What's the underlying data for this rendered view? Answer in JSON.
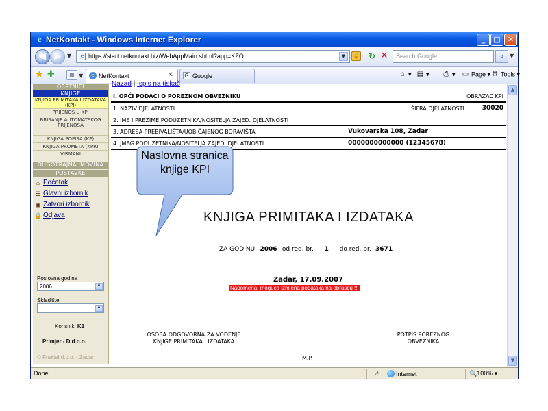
{
  "window": {
    "title": "NetKontakt - Windows Internet Explorer",
    "minimize": "_",
    "maximize": "□",
    "close": "✕"
  },
  "addressbar": {
    "url": "https://start.netkontakt.biz/WebAppMain.shtml?app=KZO",
    "search_placeholder": "Search Google"
  },
  "tabs": [
    {
      "label": "NetKontakt",
      "active": true
    },
    {
      "label": "Google",
      "active": false
    }
  ],
  "commands": {
    "page": "Page",
    "tools": "Tools"
  },
  "sidebar": {
    "header1": "OBRTNICI",
    "header2": "KNJIGE",
    "items": [
      "KNJIGA PRIMITAKA I IZDATAKA (KPI)",
      "PRIJENOS U KPI",
      "BRISANJE AUTOMATSKOG PRIJENOSA",
      "KNJIGA POPISA (KP)",
      "KNJIGA PROMETA (KPR)",
      "VIRMANI"
    ],
    "header3": "DUGOTRAJNA IMOVINA",
    "header4": "POSTAVKE",
    "links": [
      "Početak",
      "Glavni izbornik",
      "Zatvori izbornik",
      "Odjava"
    ],
    "year_label": "Poslovna godina",
    "year_value": "2006",
    "warehouse_label": "Skladište",
    "warehouse_value": "",
    "user_label": "Korisnik:",
    "user_value": "K1",
    "company": "Primjer - D d.o.o.",
    "footer": "© Fraktal d.o.o. - Zadar"
  },
  "main": {
    "link_back": "Nazad",
    "link_print": "Ispis na tiskač",
    "sep": "|",
    "row1_left": "I. OPĆI PODACI O POREZNOM OBVEZNIKU",
    "row1_right": "OBRAZAC KPI",
    "row2_left": "1. NAZIV DJELATNOSTI",
    "row2_code_label": "ŠIFRA DJELATNOSTI",
    "row2_code_value": "30020",
    "row3_left": "2. IME I PREZIME PODUZETNIKA/NOSITELJA ZAJED. DJELATNOSTI",
    "row4_left": "3. ADRESA PREBIVALIŠTA/UOBIČAJENOG BORAVIŠTA",
    "row4_value": "Vukovarska 108, Zadar",
    "row5_left": "4. JMBG PODUZETNIKA/NOSITELJA ZAJED. DJELATNOSTI",
    "row5_value": "0000000000000 (12345678)",
    "callout": "Naslovna stranica knjige KPI",
    "title": "KNJIGA PRIMITAKA I IZDATAKA",
    "year_prefix": "ZA GODINU",
    "year": "2006",
    "from_label": "od red. br.",
    "from": "1",
    "to_label": "do red. br.",
    "to": "3671",
    "date": "Zadar, 17.09.2007",
    "notice": "Napomena: moguća izmjena podataka na obrascu !!!",
    "sig_left_line1": "OSOBA ODGOVORNA ZA VOĐENJE",
    "sig_left_line2": "KNJIGE PRIMITAKA I IZDATAKA",
    "sig_right_line1": "POTPIS POREZNOG",
    "sig_right_line2": "OBVEZNIKA",
    "mp": "M.P."
  },
  "statusbar": {
    "left": "Done",
    "zone": "Internet",
    "zoom": "100%"
  }
}
